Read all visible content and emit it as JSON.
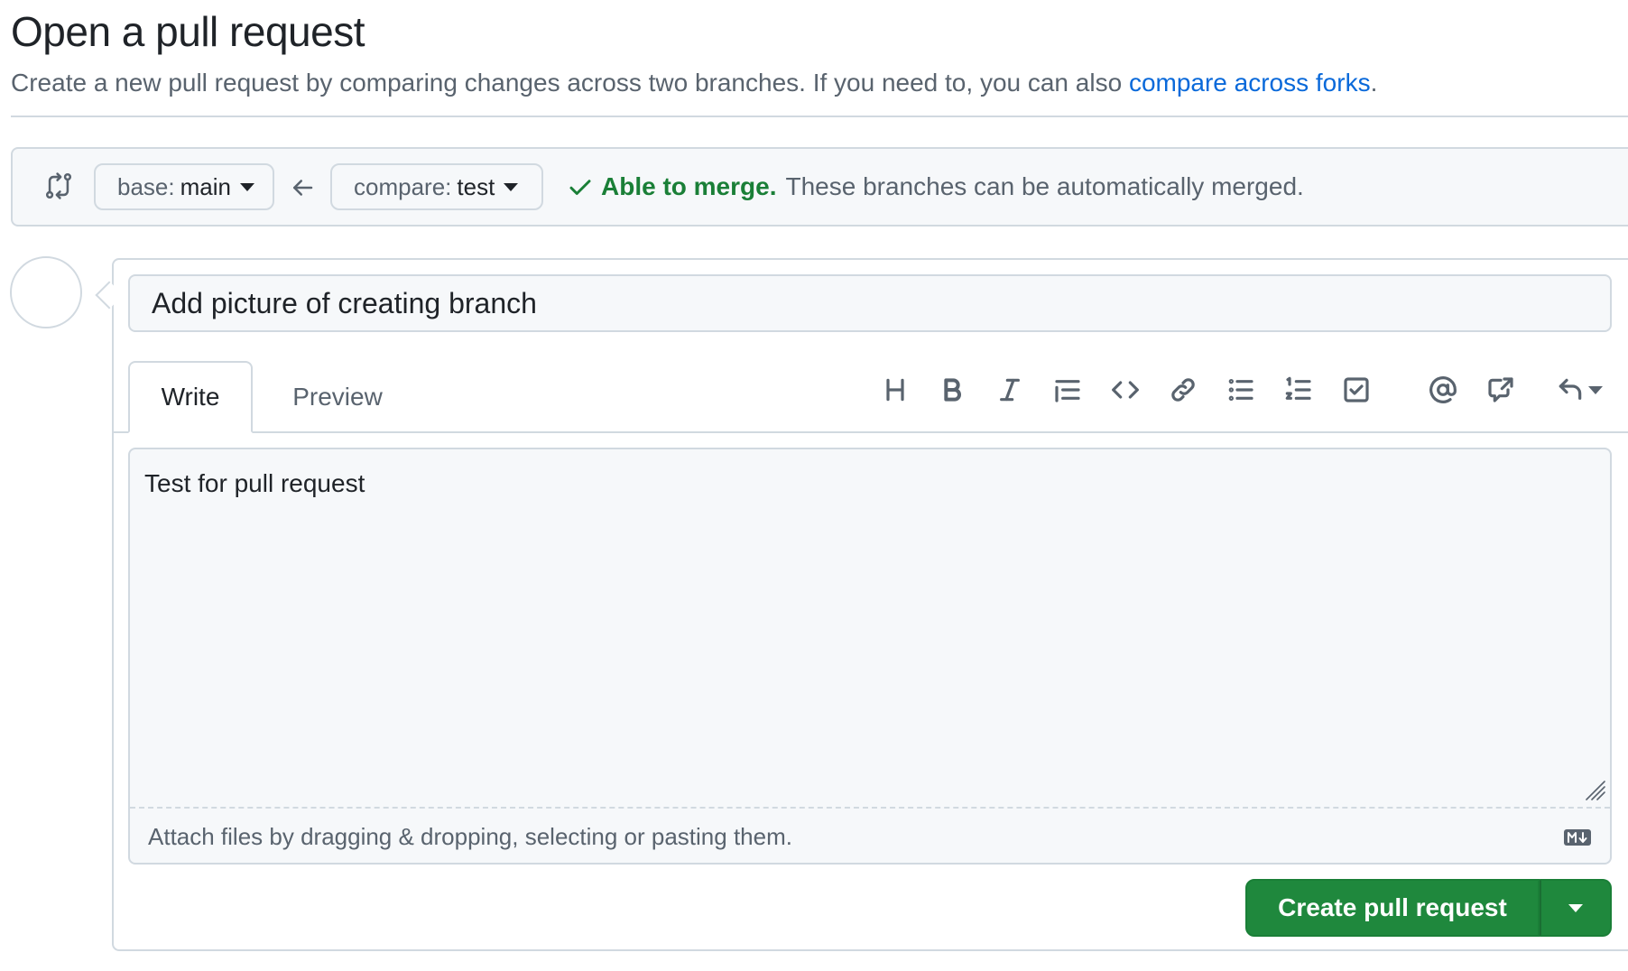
{
  "header": {
    "title": "Open a pull request",
    "subtitle": "Create a new pull request by comparing changes across two branches. If you need to, you can also ",
    "forks_link": "compare across forks",
    "subtitle_end": "."
  },
  "compare": {
    "base_prefix": "base:",
    "base_branch": "main",
    "compare_prefix": "compare:",
    "compare_branch": "test",
    "merge_ok": "Able to merge.",
    "merge_text": "These branches can be automatically merged.",
    "status_color": "#1a7f37"
  },
  "form": {
    "title_value": "Add picture of creating branch",
    "tabs": [
      {
        "label": "Write",
        "active": true
      },
      {
        "label": "Preview",
        "active": false
      }
    ],
    "toolbar": [
      "heading-icon",
      "bold-icon",
      "italic-icon",
      "quote-icon",
      "code-icon",
      "link-icon",
      "unordered-list-icon",
      "ordered-list-icon",
      "task-list-icon",
      "mention-icon",
      "cross-reference-icon",
      "saved-replies-icon"
    ],
    "body_value": "Test for pull request",
    "attach_text": "Attach files by dragging & dropping, selecting or pasting them.",
    "submit_label": "Create pull request",
    "accent_color": "#1f883d"
  }
}
